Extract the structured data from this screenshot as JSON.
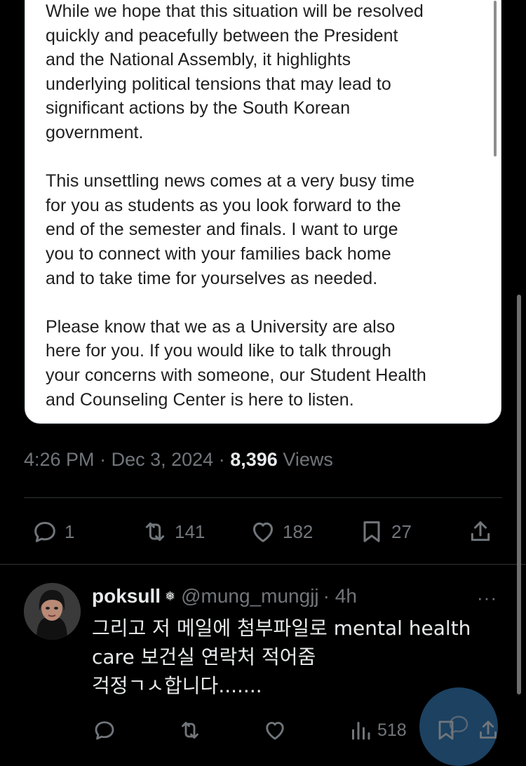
{
  "email_card": {
    "paragraphs": [
      "While we hope that this situation will be resolved\nquickly and peacefully between the President\nand the National Assembly, it highlights\nunderlying political tensions that may lead to\nsignificant actions by the South Korean\ngovernment.",
      "This unsettling news comes at a very busy time\nfor you as students as you look forward to the\nend of the semester and finals. I want to urge\nyou to connect with your families back home\nand to take time for yourselves as needed.",
      "Please know that we as a University are also\nhere for you. If you would like to talk through\nyour concerns with someone, our Student Health\nand Counseling Center is here to listen."
    ]
  },
  "post_meta": {
    "time": "4:26 PM",
    "separator": "·",
    "date": "Dec 3, 2024",
    "views_count": "8,396",
    "views_label": "Views"
  },
  "post_actions": {
    "replies": "1",
    "reposts": "141",
    "likes": "182",
    "bookmarks": "27"
  },
  "reply": {
    "display_name": "poksull",
    "badge": "❅",
    "handle": "@mung_mungjj",
    "time": "· 4h",
    "more": "···",
    "lines": [
      "그리고 저 메일에 첨부파일로 mental health",
      "care 보건실 연락처 적어줌",
      "걱정ㄱㅅ합니다......."
    ],
    "views": "518"
  },
  "colors": {
    "background": "#000000",
    "text": "#e7e9ea",
    "muted": "#71767b",
    "card": "#ffffff",
    "fab": "#1d4466"
  }
}
